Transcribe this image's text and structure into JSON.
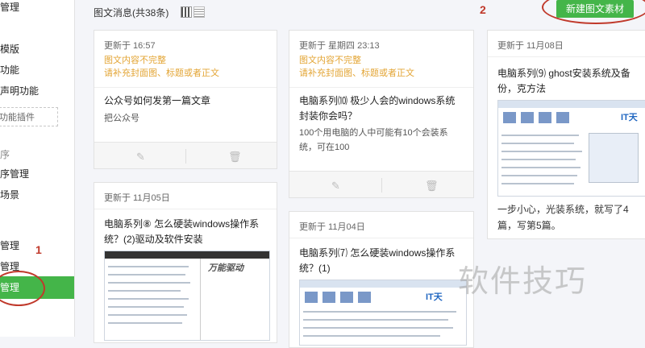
{
  "sidebar": {
    "items": [
      "管理",
      "模版",
      "功能",
      "声明功能",
      "序",
      "序管理",
      "场景",
      "管理",
      "管理"
    ],
    "plugin_link": "功能插件",
    "active_item": "管理"
  },
  "annotations": {
    "left_marker": "1",
    "right_marker": "2"
  },
  "header": {
    "title": "图文消息(共38条)",
    "new_button": "新建图文素材"
  },
  "cards": [
    {
      "date": "更新于 16:57",
      "warning_line1": "图文内容不完整",
      "warning_line2": "请补充封面图、标题或者正文",
      "title": "公众号如何发第一篇文章",
      "desc": "把公众号"
    },
    {
      "date": "更新于 11月05日",
      "title": "电脑系列⑧ 怎么硬装windows操作系统？(2)驱动及软件安装",
      "thumb_logo": "万能驱动"
    },
    {
      "date": "更新于 星期四 23:13",
      "warning_line1": "图文内容不完整",
      "warning_line2": "请补充封面图、标题或者正文",
      "title": "电脑系列⑽ 极少人会的windows系统封装你会吗？",
      "desc": "100个用电脑的人中可能有10个会装系统，可在100"
    },
    {
      "date": "更新于 11月04日",
      "title": "电脑系列⑺ 怎么硬装windows操作系统？(1)",
      "thumb_logo": "IT天"
    },
    {
      "date": "更新于 11月08日",
      "title": "电脑系列⑼ ghost安装系统及备份，克方法",
      "thumb_logo": "IT天",
      "desc": "一步小心，光装系统，就写了4篇，写第5篇。"
    }
  ],
  "watermark": "软件技巧"
}
